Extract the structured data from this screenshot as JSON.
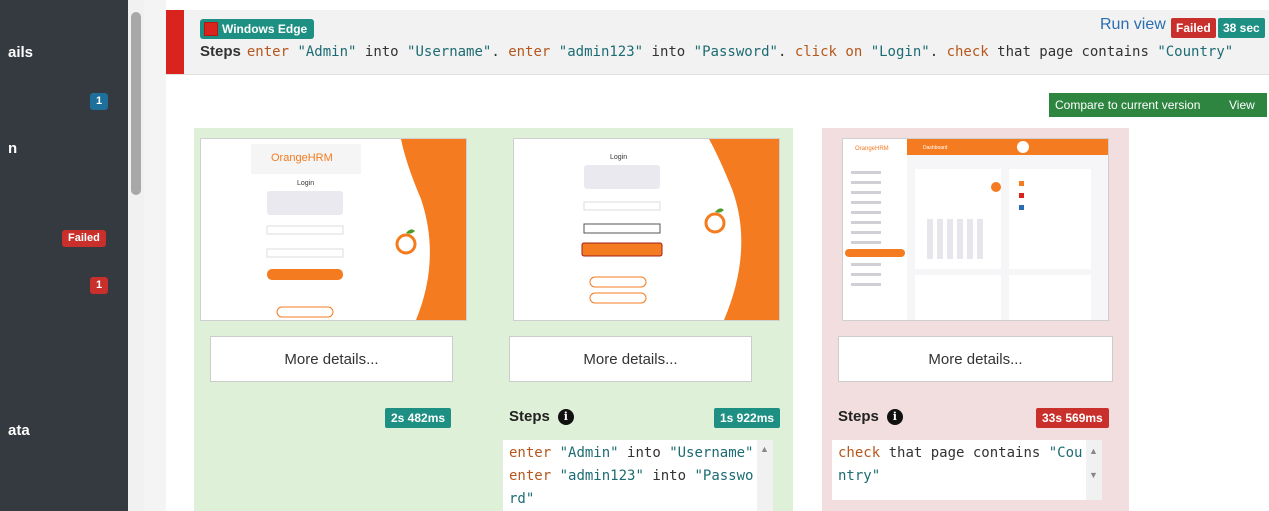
{
  "sidebar": {
    "items": [
      {
        "label": "ails"
      },
      {
        "label": "n"
      },
      {
        "label": "ata"
      }
    ],
    "badges": [
      {
        "text": "1",
        "color": "#1e6f9a"
      },
      {
        "text": "Failed",
        "color": "#c9302c"
      },
      {
        "text": "1",
        "color": "#c9302c"
      }
    ]
  },
  "header": {
    "env": "Windows Edge",
    "steps_label": "Steps",
    "steps": [
      {
        "t": "enter",
        "k": "kw"
      },
      {
        "t": " ",
        "k": ""
      },
      {
        "t": "\"Admin\"",
        "k": "str"
      },
      {
        "t": " into ",
        "k": ""
      },
      {
        "t": "\"Username\"",
        "k": "str"
      },
      {
        "t": ". ",
        "k": ""
      },
      {
        "t": "enter",
        "k": "kw"
      },
      {
        "t": " ",
        "k": ""
      },
      {
        "t": "\"admin123\"",
        "k": "str"
      },
      {
        "t": " into ",
        "k": ""
      },
      {
        "t": "\"Password\"",
        "k": "str"
      },
      {
        "t": ". ",
        "k": ""
      },
      {
        "t": "click on",
        "k": "kw"
      },
      {
        "t": " ",
        "k": ""
      },
      {
        "t": "\"Login\"",
        "k": "str"
      },
      {
        "t": ". ",
        "k": ""
      },
      {
        "t": "check",
        "k": "kw"
      },
      {
        "t": " that page contains ",
        "k": ""
      },
      {
        "t": "\"Country\"",
        "k": "str"
      }
    ],
    "run_view": "Run view",
    "status": "Failed",
    "duration": "38 sec"
  },
  "toolbar": {
    "compare_label": "Compare to current version",
    "view_label": "View"
  },
  "colors": {
    "accent_teal": "#1e8f83",
    "danger": "#c9302c",
    "success_bg": "#dff0d8",
    "fail_bg": "#f2dede",
    "brand_orange": "#f47b20"
  },
  "thumbnails": {
    "brand": "OrangeHRM",
    "login_title": "Login",
    "dashboard_title": "Dashboard"
  },
  "cards": [
    {
      "more": "More details...",
      "time": "2s 482ms",
      "status": "passed"
    },
    {
      "more": "More details...",
      "steps_label": "Steps",
      "time": "1s 922ms",
      "status": "passed",
      "code": [
        {
          "t": "enter",
          "k": "kw"
        },
        {
          "t": " ",
          "k": ""
        },
        {
          "t": "\"Admin\"",
          "k": "str"
        },
        {
          "t": " into ",
          "k": ""
        },
        {
          "t": "\"Username\"",
          "k": "str"
        },
        {
          "t": "\n",
          "k": ""
        },
        {
          "t": "enter",
          "k": "kw"
        },
        {
          "t": " ",
          "k": ""
        },
        {
          "t": "\"admin123\"",
          "k": "str"
        },
        {
          "t": " into ",
          "k": ""
        },
        {
          "t": "\"Password\"",
          "k": "str"
        }
      ]
    },
    {
      "more": "More details...",
      "steps_label": "Steps",
      "time": "33s 569ms",
      "status": "failed",
      "code": [
        {
          "t": "check",
          "k": "kw"
        },
        {
          "t": " that page contains ",
          "k": ""
        },
        {
          "t": "\"Country\"",
          "k": "str"
        }
      ]
    }
  ]
}
